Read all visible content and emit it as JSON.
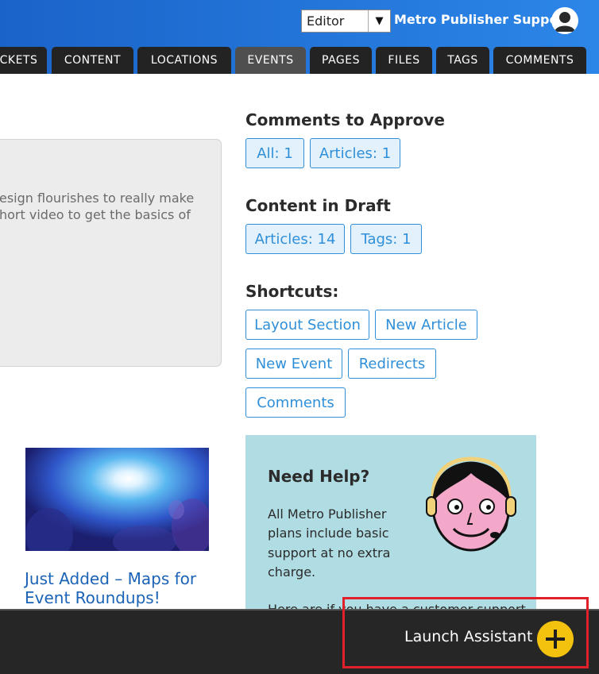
{
  "header": {
    "role_select": {
      "value": "Editor"
    },
    "account_name": "Metro Publisher Support"
  },
  "nav": {
    "tabs": [
      {
        "label": "CKETS"
      },
      {
        "label": "CONTENT"
      },
      {
        "label": "LOCATIONS"
      },
      {
        "label": "EVENTS",
        "active": true
      },
      {
        "label": "PAGES"
      },
      {
        "label": "FILES"
      },
      {
        "label": "TAGS"
      },
      {
        "label": "COMMENTS"
      }
    ]
  },
  "intro_card": {
    "lines": [
      "esign flourishes to really make",
      "hort video to get the basics of"
    ]
  },
  "latest_post": {
    "title": "Just Added – Maps for Event Roundups!"
  },
  "comments_to_approve": {
    "heading": "Comments to Approve",
    "chips": [
      "All: 1",
      "Articles: 1"
    ]
  },
  "content_in_draft": {
    "heading": "Content in Draft",
    "chips": [
      "Articles: 14",
      "Tags: 1"
    ]
  },
  "shortcuts": {
    "heading": "Shortcuts:",
    "items": [
      "Layout Section",
      "New Article",
      "New Event",
      "Redirects",
      "Comments"
    ]
  },
  "help": {
    "title": "Need Help?",
    "lines": [
      "All Metro Publisher",
      "plans include basic",
      "support at no extra",
      "charge."
    ],
    "cut_line": "Here  are  if  you  have  a  customer  support"
  },
  "assistant": {
    "label": "Launch Assistant"
  },
  "colors": {
    "header_blue": "#1a63c9",
    "tab_dark": "#232323",
    "tab_active": "#4f4f4f",
    "link_blue": "#2f8fd8",
    "help_bg": "#b0dde3",
    "assistant_yellow": "#f2c20f",
    "highlight_red": "#e0202a"
  }
}
